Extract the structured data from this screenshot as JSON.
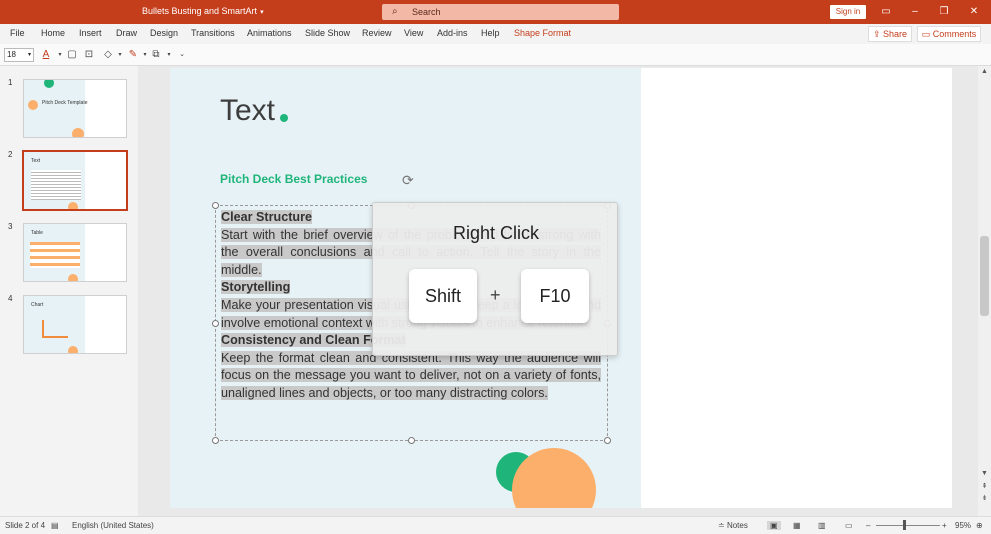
{
  "titlebar": {
    "doc_title": "Bullets Busting and SmartArt",
    "search_placeholder": "Search",
    "sign_in": "Sign in"
  },
  "menu": {
    "tabs": [
      "File",
      "Home",
      "Insert",
      "Draw",
      "Design",
      "Transitions",
      "Animations",
      "Slide Show",
      "Review",
      "View",
      "Add-ins",
      "Help",
      "Shape Format"
    ],
    "active_tab": "Shape Format",
    "share_label": "Share",
    "comments_label": "Comments"
  },
  "ribbon": {
    "font_size": "18"
  },
  "thumbnails": [
    {
      "num": "1",
      "title": "Pitch Deck Template"
    },
    {
      "num": "2",
      "title": "Text"
    },
    {
      "num": "3",
      "title": "Table"
    },
    {
      "num": "4",
      "title": "Chart"
    }
  ],
  "slide": {
    "title": "Text",
    "subtitle": "Pitch Deck Best Practices",
    "heading1": "Clear Structure",
    "para1": "Start with the brief overview of the problem and finish strong with the overall conclusions and call to action. Tell the story in the middle.",
    "heading2": "Storytelling",
    "para2": "Make your presentation visual using words. Keep a logical flow and involve emotional context with strong visuals to enhance retention.",
    "heading3": "Consistency and Clean Format",
    "para3": "Keep the format clean and consistent. This way the audience will focus on the message you want to deliver, not on a variety of fonts, unaligned lines and objects, or too many distracting colors."
  },
  "shortcut_overlay": {
    "title": "Right Click",
    "key1": "Shift",
    "plus": "+",
    "key2": "F10"
  },
  "status": {
    "slide_info": "Slide 2 of 4",
    "language": "English (United States)",
    "notes": "Notes",
    "zoom": "95%"
  },
  "colors": {
    "brand": "#c43e1c",
    "accent_green": "#1fb57a",
    "accent_orange": "#fbaf6a",
    "slide_panel": "#e7f2f6"
  }
}
